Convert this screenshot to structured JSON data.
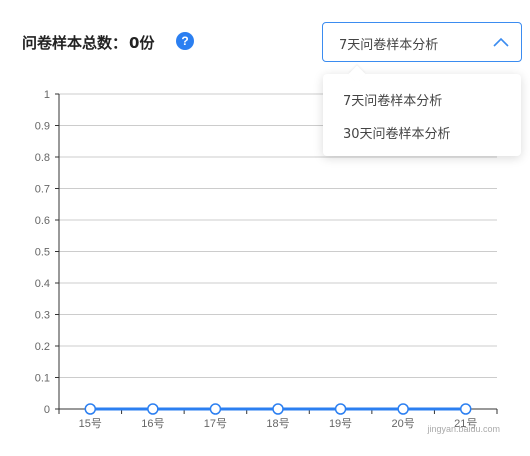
{
  "header": {
    "title": "问卷样本总数：",
    "count": "0份",
    "help_symbol": "?"
  },
  "select": {
    "value": "7天问卷样本分析",
    "options": [
      "7天问卷样本分析",
      "30天问卷样本分析"
    ]
  },
  "colors": {
    "accent": "#2b7ff1",
    "line": "#2b7ff1",
    "grid": "#cccccc"
  },
  "watermark": "jingyan.baidu.com",
  "chart_data": {
    "type": "line",
    "categories": [
      "15号",
      "16号",
      "17号",
      "18号",
      "19号",
      "20号",
      "21号"
    ],
    "values": [
      0,
      0,
      0,
      0,
      0,
      0,
      0
    ],
    "ylim": [
      0,
      1
    ],
    "yticks": [
      "0",
      "0.1",
      "0.2",
      "0.3",
      "0.4",
      "0.5",
      "0.6",
      "0.7",
      "0.8",
      "0.9",
      "1"
    ],
    "grid": true
  }
}
